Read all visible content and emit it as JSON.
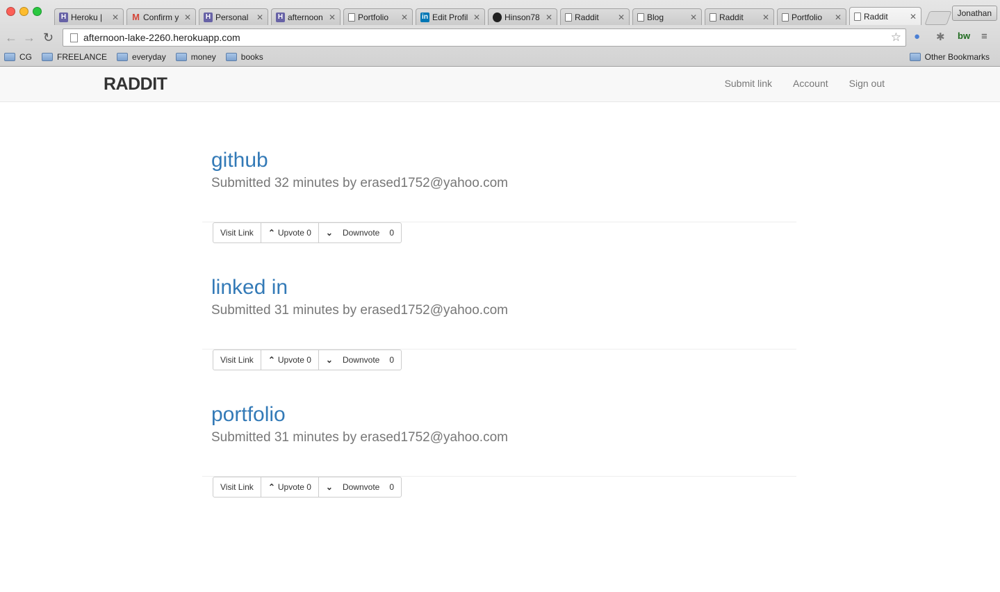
{
  "browser": {
    "tabs": [
      {
        "title": "Heroku | ",
        "favicon": "heroku-icon"
      },
      {
        "title": "Confirm y",
        "favicon": "gmail-icon"
      },
      {
        "title": "Personal",
        "favicon": "heroku-icon"
      },
      {
        "title": "afternoon",
        "favicon": "heroku-icon"
      },
      {
        "title": "Portfolio",
        "favicon": "page-icon"
      },
      {
        "title": "Edit Profil",
        "favicon": "linkedin-icon"
      },
      {
        "title": "Hinson78",
        "favicon": "github-icon"
      },
      {
        "title": "Raddit",
        "favicon": "page-icon"
      },
      {
        "title": "Blog",
        "favicon": "page-icon"
      },
      {
        "title": "Raddit",
        "favicon": "page-icon"
      },
      {
        "title": "Portfolio",
        "favicon": "page-icon"
      },
      {
        "title": "Raddit",
        "favicon": "page-icon",
        "active": true
      }
    ],
    "profile_name": "Jonathan",
    "url": "afternoon-lake-2260.herokuapp.com",
    "bookmarks": [
      "CG",
      "FREELANCE",
      "everyday",
      "money",
      "books"
    ],
    "other_bookmarks": "Other Bookmarks"
  },
  "site": {
    "brand": "RADDIT",
    "nav": {
      "submit": "Submit link",
      "account": "Account",
      "signout": "Sign out"
    }
  },
  "posts": [
    {
      "title": "github",
      "meta": "Submitted 32 minutes by erased1752@yahoo.com",
      "visit": "Visit Link",
      "upvote": "Upvote 0",
      "downvote": "Downvote",
      "down_count": "0"
    },
    {
      "title": "linked in",
      "meta": "Submitted 31 minutes by erased1752@yahoo.com",
      "visit": "Visit Link",
      "upvote": "Upvote 0",
      "downvote": "Downvote",
      "down_count": "0"
    },
    {
      "title": "portfolio",
      "meta": "Submitted 31 minutes by erased1752@yahoo.com",
      "visit": "Visit Link",
      "upvote": "Upvote 0",
      "downvote": "Downvote",
      "down_count": "0"
    }
  ],
  "colors": {
    "link": "#337ab7",
    "muted": "#777777",
    "brand": "#333333"
  }
}
